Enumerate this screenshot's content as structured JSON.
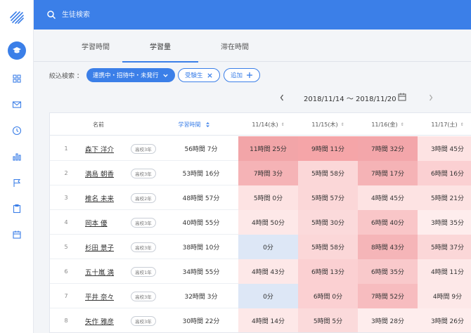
{
  "search": {
    "placeholder": "生徒検索"
  },
  "tabs": [
    {
      "label": "学習時間",
      "active": false
    },
    {
      "label": "学習量",
      "active": true
    },
    {
      "label": "滞在時間",
      "active": false
    }
  ],
  "filters": {
    "label": "絞込検索 ：",
    "chips": [
      {
        "label": "連携中・招待中・未発行",
        "icon": "chevron-down-icon"
      },
      {
        "label": "受験生",
        "icon": "close-icon"
      },
      {
        "label": "追加",
        "icon": "plus-icon"
      }
    ]
  },
  "date_nav": {
    "range": "2018/11/14 〜 2018/11/20"
  },
  "table": {
    "headers": {
      "name": "名前",
      "total": "学習時間",
      "days": [
        "11/14(水)",
        "11/15(木)",
        "11/16(金)",
        "11/17(土)"
      ]
    },
    "rows": [
      {
        "no": "1",
        "name": "森下 洋介",
        "grade": "高校3年",
        "total": "56時間 7分",
        "days": [
          "11時間 25分",
          "9時間 11分",
          "7時間 32分",
          "3時間 45分"
        ]
      },
      {
        "no": "2",
        "name": "満島 朝香",
        "grade": "高校3年",
        "total": "53時間 16分",
        "days": [
          "7時間 3分",
          "5時間 58分",
          "7時間 17分",
          "6時間 16分"
        ]
      },
      {
        "no": "3",
        "name": "椎名 未来",
        "grade": "高校2年",
        "total": "48時間 57分",
        "days": [
          "5時間 0分",
          "5時間 57分",
          "4時間 45分",
          "5時間 21分"
        ]
      },
      {
        "no": "4",
        "name": "岡本 優",
        "grade": "高校3年",
        "total": "40時間 55分",
        "days": [
          "4時間 50分",
          "5時間 30分",
          "6時間 40分",
          "3時間 35分"
        ]
      },
      {
        "no": "5",
        "name": "杉田 景子",
        "grade": "高校3年",
        "total": "38時間 10分",
        "days": [
          "0分",
          "5時間 58分",
          "8時間 43分",
          "5時間 37分"
        ]
      },
      {
        "no": "6",
        "name": "五十嵐 満",
        "grade": "高校1年",
        "total": "34時間 55分",
        "days": [
          "4時間 43分",
          "6時間 13分",
          "6時間 35分",
          "4時間 11分"
        ]
      },
      {
        "no": "7",
        "name": "平井 奈々",
        "grade": "高校3年",
        "total": "32時間 3分",
        "days": [
          "0分",
          "6時間 0分",
          "7時間 52分",
          "4時間 9分"
        ]
      },
      {
        "no": "8",
        "name": "矢作 雅彦",
        "grade": "高校3年",
        "total": "30時間 22分",
        "days": [
          "4時間 14分",
          "5時間 5分",
          "3時間 28分",
          "3時間 26分"
        ]
      }
    ],
    "heat_colors": [
      [
        "#f2a5a8",
        "#f5a5a8",
        "#f3a6aa",
        "#fde3e3"
      ],
      [
        "#f5b3b6",
        "#fbd7d8",
        "#f5b3b6",
        "#fbd0d2"
      ],
      [
        "#fde3e3",
        "#fbd7d8",
        "#fde3e3",
        "#fde3e3"
      ],
      [
        "#fde8e8",
        "#fbdadb",
        "#f9c6c8",
        "#feeded"
      ],
      [
        "#dde7f6",
        "#fbd7d8",
        "#f5b5b8",
        "#fbd7d8"
      ],
      [
        "#fde8e8",
        "#fbd0d2",
        "#f9c9cb",
        "#fde8e8"
      ],
      [
        "#dde7f6",
        "#fbd0d2",
        "#f7bcbf",
        "#fde8e8"
      ],
      [
        "#fde8e8",
        "#fbdadb",
        "#feeded",
        "#feeded"
      ]
    ]
  },
  "colors": {
    "accent": "#3b7fe8"
  }
}
